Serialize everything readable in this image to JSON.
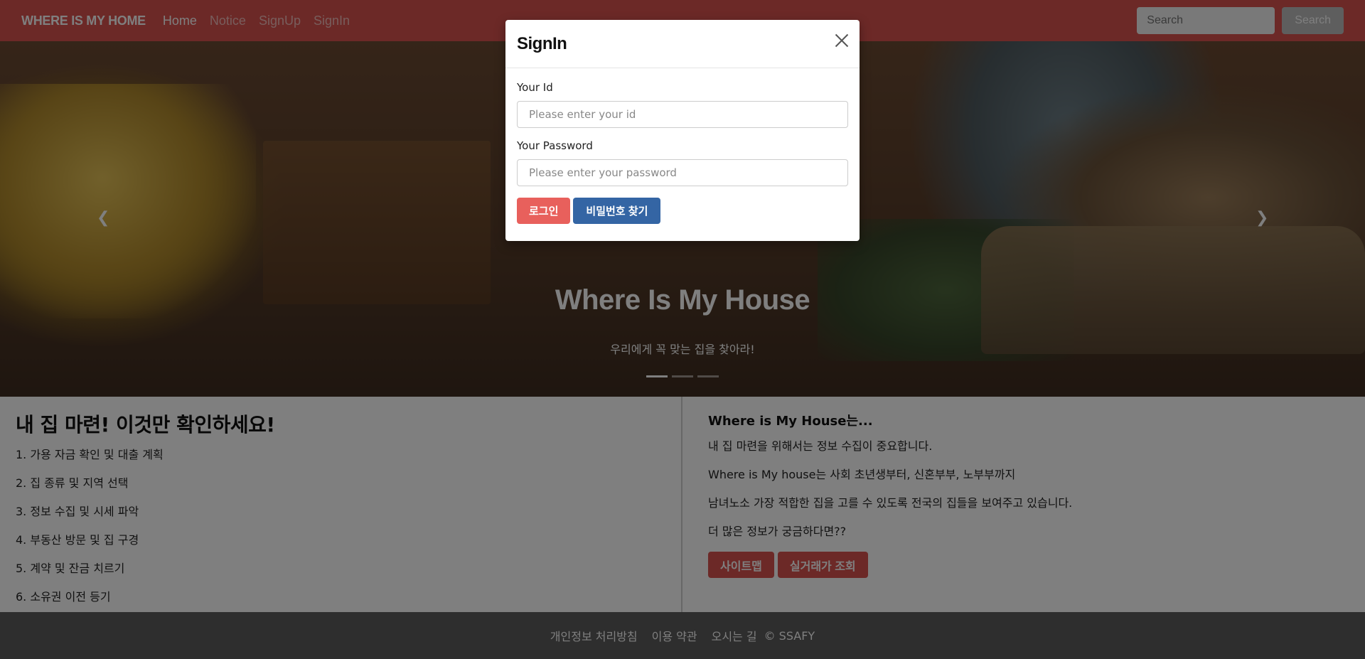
{
  "navbar": {
    "brand": "WHERE IS MY HOME",
    "links": [
      {
        "label": "Home"
      },
      {
        "label": "Notice"
      },
      {
        "label": "SignUp"
      },
      {
        "label": "SignIn"
      }
    ],
    "search_placeholder": "Search",
    "search_button": "Search"
  },
  "hero": {
    "title": "Where Is My House",
    "subtitle": "우리에게 꼭 맞는 집을 찾아라!",
    "prev_icon": "chevron-left-icon",
    "next_icon": "chevron-right-icon",
    "slides": 3,
    "active_slide": 1
  },
  "left": {
    "title": "내 집 마련! 이것만 확인하세요!",
    "steps": [
      "1. 가용 자금 확인 및 대출 계획",
      "2. 집 종류 및 지역 선택",
      "3. 정보 수집 및 시세 파악",
      "4. 부동산 방문 및 집 구경",
      "5. 계약 및 잔금 치르기",
      "6. 소유권 이전 등기"
    ]
  },
  "right": {
    "title": "Where is My House는...",
    "paragraphs": [
      "내 집 마련을 위해서는 정보 수집이 중요합니다.",
      "Where is My house는 사회 초년생부터, 신혼부부, 노부부까지",
      "남녀노소 가장 적합한 집을 고를 수 있도록 전국의 집들을 보여주고 있습니다.",
      "더 많은 정보가 궁금하다면??"
    ],
    "buttons": [
      "사이트맵",
      "실거래가 조회"
    ]
  },
  "footer": {
    "links": [
      "개인정보 처리방침",
      "이용 약관",
      "오시는 길"
    ],
    "copyright": "© SSAFY"
  },
  "modal": {
    "title": "SignIn",
    "close_icon": "close-icon",
    "id_label": "Your Id",
    "id_placeholder": "Please enter your id",
    "password_label": "Your Password",
    "password_placeholder": "Please enter your password",
    "login_button": "로그인",
    "find_password_button": "비밀번호 찾기"
  },
  "colors": {
    "navbar": "#d9534f",
    "primary_button": "#3465a4",
    "danger_button": "#d9534f",
    "footer": "#5c5c5c"
  }
}
